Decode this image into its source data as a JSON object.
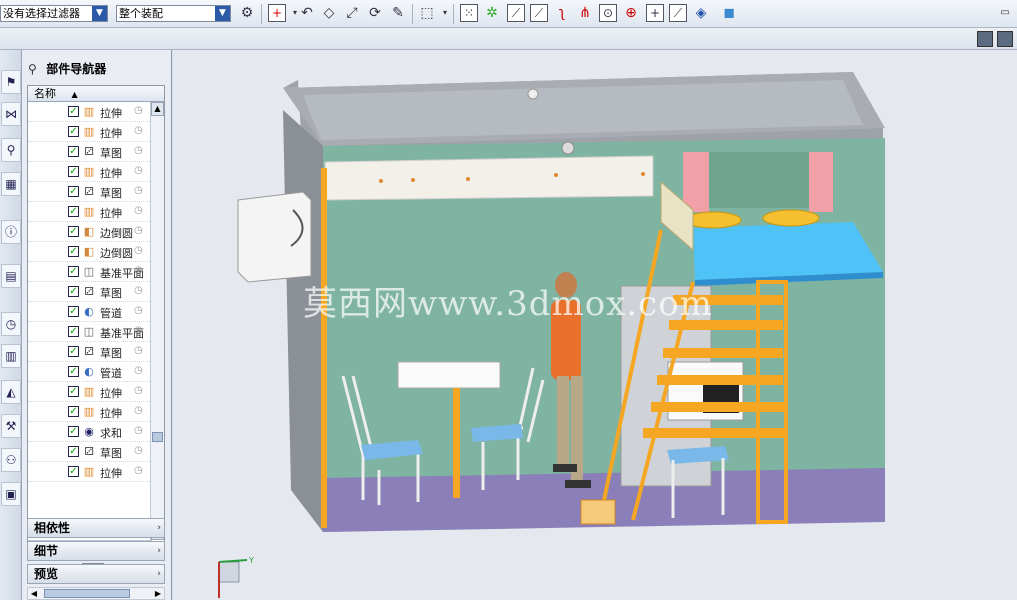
{
  "toolbar": {
    "filter_combo": "没有选择过滤器",
    "assembly_combo": "整个装配"
  },
  "part_navigator": {
    "title": "部件导航器",
    "column_name": "名称",
    "rows": [
      {
        "icon": "extrude-icon",
        "label": "拉伸"
      },
      {
        "icon": "extrude-icon",
        "label": "拉伸"
      },
      {
        "icon": "sketch-icon",
        "label": "草图"
      },
      {
        "icon": "extrude-icon",
        "label": "拉伸"
      },
      {
        "icon": "sketch-icon",
        "label": "草图"
      },
      {
        "icon": "extrude-icon",
        "label": "拉伸"
      },
      {
        "icon": "edge-blend-icon",
        "label": "边倒圆"
      },
      {
        "icon": "edge-blend-icon",
        "label": "边倒圆"
      },
      {
        "icon": "datum-plane-icon",
        "label": "基准平面"
      },
      {
        "icon": "sketch-icon",
        "label": "草图"
      },
      {
        "icon": "tube-icon",
        "label": "管道"
      },
      {
        "icon": "datum-plane-icon",
        "label": "基准平面"
      },
      {
        "icon": "sketch-icon",
        "label": "草图"
      },
      {
        "icon": "tube-icon",
        "label": "管道"
      },
      {
        "icon": "extrude-icon",
        "label": "拉伸"
      },
      {
        "icon": "extrude-icon",
        "label": "拉伸"
      },
      {
        "icon": "unite-icon",
        "label": "求和"
      },
      {
        "icon": "sketch-icon",
        "label": "草图"
      },
      {
        "icon": "extrude-icon",
        "label": "拉伸"
      }
    ],
    "sections": [
      "相依性",
      "细节",
      "预览"
    ]
  },
  "viewport": {
    "watermark": "莫西网www.3dmox.com",
    "axis_y_label": "Y",
    "colors": {
      "wall_green": "#7fb3a2",
      "floor_purple": "#8a7fb8",
      "ceiling_gray": "#a9adb3",
      "stair_orange": "#f5a623",
      "loft_blue": "#4fc3f7"
    }
  }
}
